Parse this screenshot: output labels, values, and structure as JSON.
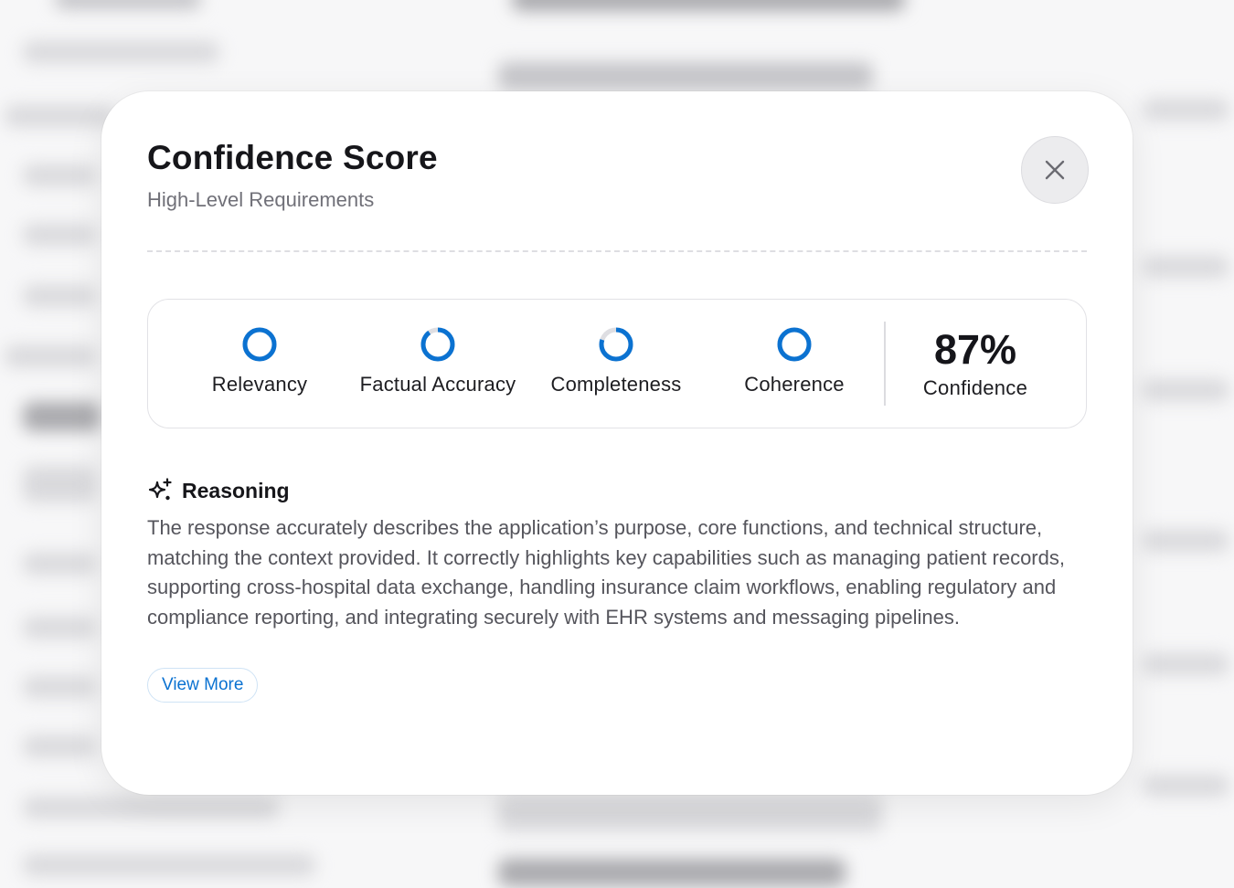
{
  "modal": {
    "title": "Confidence Score",
    "subtitle": "High-Level Requirements",
    "close_icon": "close-icon"
  },
  "metrics": [
    {
      "label": "Relevancy",
      "progress": 1.0
    },
    {
      "label": "Factual Accuracy",
      "progress": 0.9
    },
    {
      "label": "Completeness",
      "progress": 0.8
    },
    {
      "label": "Coherence",
      "progress": 1.0
    }
  ],
  "confidence": {
    "value": "87%",
    "label": "Confidence"
  },
  "reasoning": {
    "icon": "sparkle-icon",
    "title": "Reasoning",
    "text": "The response accurately describes the application’s purpose, core functions, and technical structure, matching the context provided. It correctly highlights key capabilities such as managing patient records, supporting cross-hospital data exchange, handling insurance claim workflows, enabling regulatory and compliance reporting, and integrating securely with EHR systems and messaging pipelines.",
    "view_more_label": "View More"
  },
  "colors": {
    "accent": "#0b72d1",
    "ring_track": "#dedee2"
  }
}
